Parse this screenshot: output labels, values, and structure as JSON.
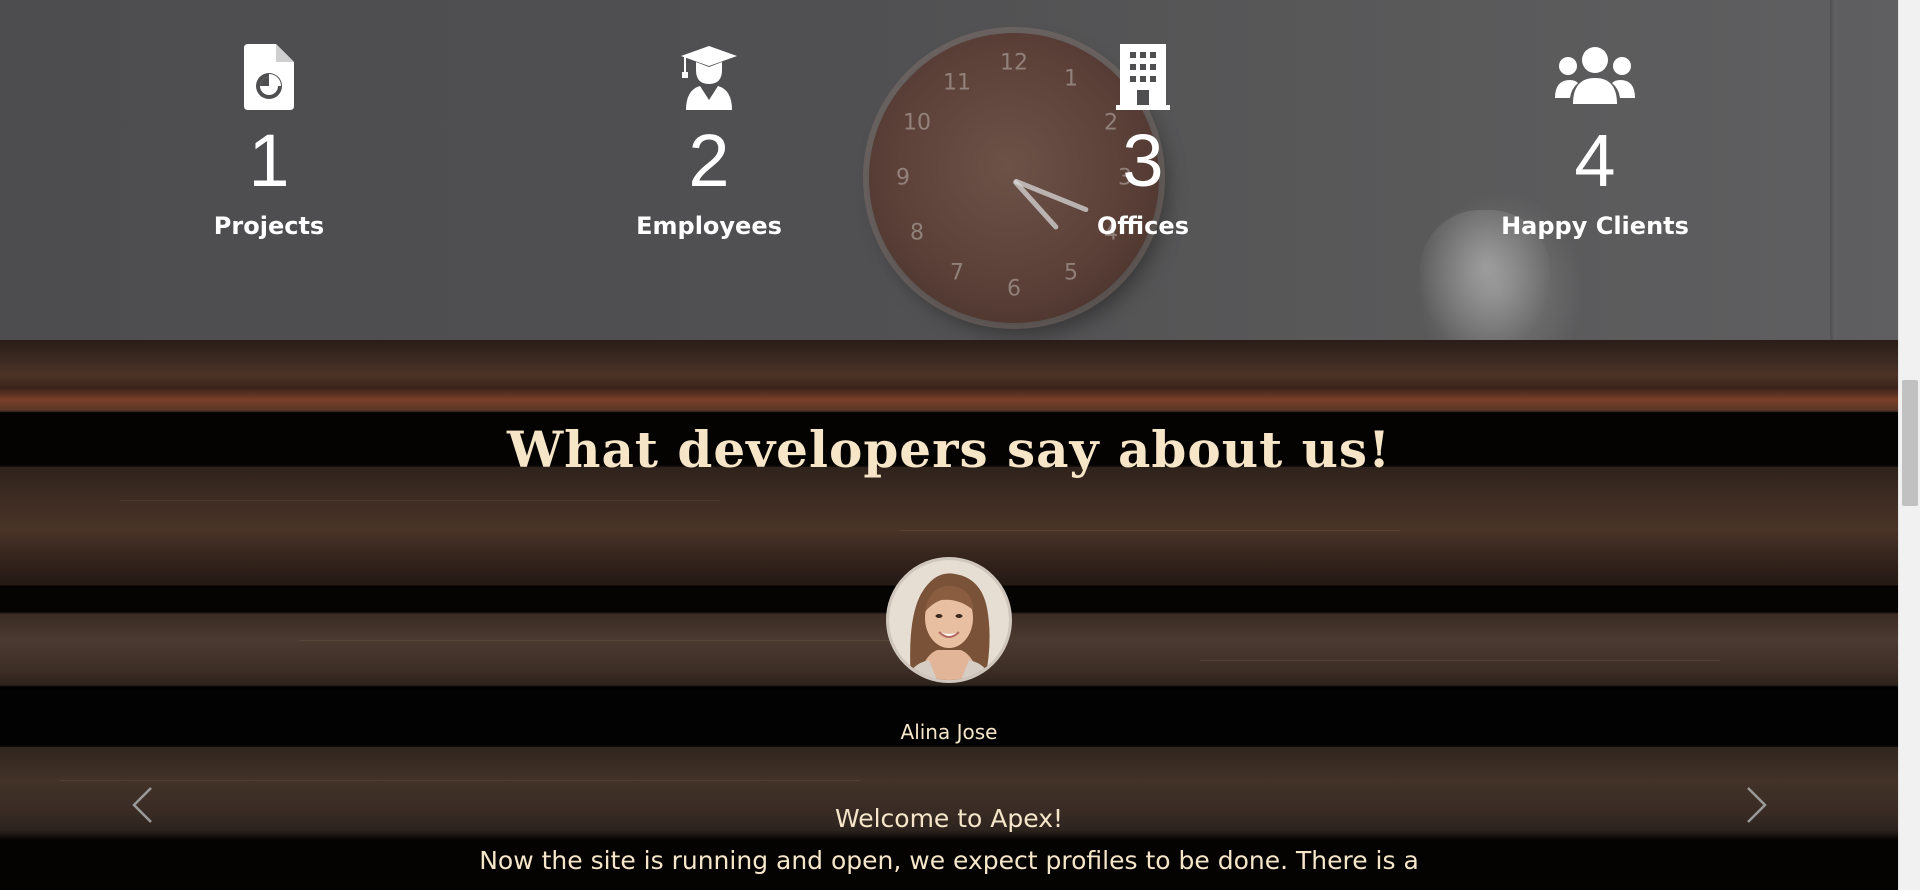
{
  "stats": [
    {
      "icon": "file-chart-icon",
      "number": "1",
      "label": "Projects"
    },
    {
      "icon": "graduate-icon",
      "number": "2",
      "label": "Employees"
    },
    {
      "icon": "building-icon",
      "number": "3",
      "label": "Offices"
    },
    {
      "icon": "users-icon",
      "number": "4",
      "label": "Happy Clients"
    }
  ],
  "testimonials": {
    "title": "What developers say about us!",
    "author": "Alina Jose",
    "greeting": "Welcome to Apex!",
    "body": "Now the site is running and open, we expect profiles to be done. There is a",
    "prev_icon": "chevron-left-icon",
    "next_icon": "chevron-right-icon"
  },
  "colors": {
    "title": "#f7e5c7",
    "text": "#f6e6c9",
    "stat_text": "#ffffff"
  }
}
